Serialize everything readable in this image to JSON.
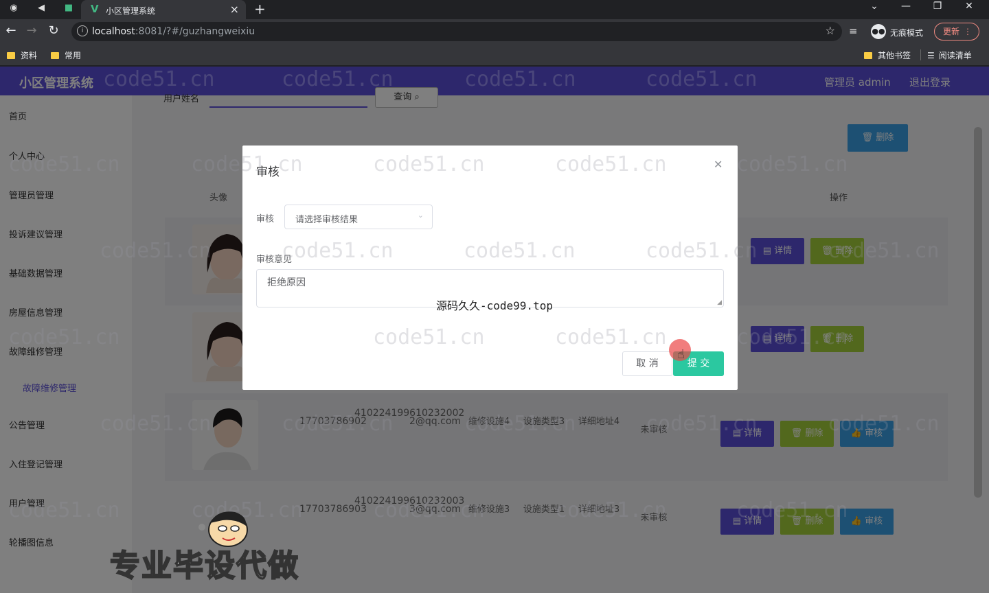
{
  "browser": {
    "tab_title": "小区管理系统",
    "url_host": "localhost",
    "url_rest": ":8081/?#/guzhangweixiu",
    "incognito_label": "无痕模式",
    "update_label": "更新",
    "bookmarks": [
      {
        "label": "资料"
      },
      {
        "label": "常用"
      },
      {
        "label": "其他书签"
      },
      {
        "label": "阅读清单"
      }
    ]
  },
  "header": {
    "brand": "小区管理系统",
    "user": "管理员 admin",
    "logout": "退出登录",
    "color": "#5b4fd8"
  },
  "sidebar": {
    "items": [
      {
        "label": "首页"
      },
      {
        "label": "个人中心"
      },
      {
        "label": "管理员管理"
      },
      {
        "label": "投诉建议管理"
      },
      {
        "label": "基础数据管理"
      },
      {
        "label": "房屋信息管理"
      },
      {
        "label": "故障维修管理"
      },
      {
        "label": "故障维修管理"
      },
      {
        "label": "公告管理"
      },
      {
        "label": "入住登记管理"
      },
      {
        "label": "用户管理"
      },
      {
        "label": "轮播图信息"
      }
    ]
  },
  "toolbar": {
    "search_label": "用户姓名",
    "search_button": "查询",
    "bulk_delete": "删除"
  },
  "table": {
    "headers": {
      "avatar": "头像",
      "ops": "操作"
    },
    "rows": [
      {
        "phone": "",
        "id_card": "",
        "email": "",
        "facility": "",
        "type": "",
        "address": "",
        "status": "",
        "buttons": [
          "详情",
          "删除"
        ]
      },
      {
        "phone": "",
        "id_card": "",
        "email": "",
        "facility": "",
        "type": "",
        "address": "",
        "status": "",
        "buttons": [
          "详情",
          "删除"
        ]
      },
      {
        "phone": "17703786902",
        "id_card": "410224199610232002",
        "email": "2@qq.com",
        "facility": "维修设施4",
        "type": "设施类型3",
        "address": "详细地址4",
        "status": "未审核",
        "buttons": [
          "详情",
          "删除",
          "审核"
        ]
      },
      {
        "phone": "17703786903",
        "id_card": "410224199610232003",
        "email": "3@qq.com",
        "facility": "维修设施3",
        "type": "设施类型1",
        "address": "详细地址3",
        "status": "未审核",
        "buttons": [
          "详情",
          "删除",
          "审核"
        ]
      }
    ]
  },
  "dialog": {
    "title": "审核",
    "select_label": "审核",
    "select_placeholder": "请选择审核结果",
    "opinion_label": "审核意见",
    "opinion_placeholder": "拒绝原因",
    "cancel": "取 消",
    "submit": "提 交"
  },
  "overlay": {
    "watermark": "code51.cn",
    "center_text": "源码久久-code99.top",
    "promo": "专业毕设代做"
  }
}
